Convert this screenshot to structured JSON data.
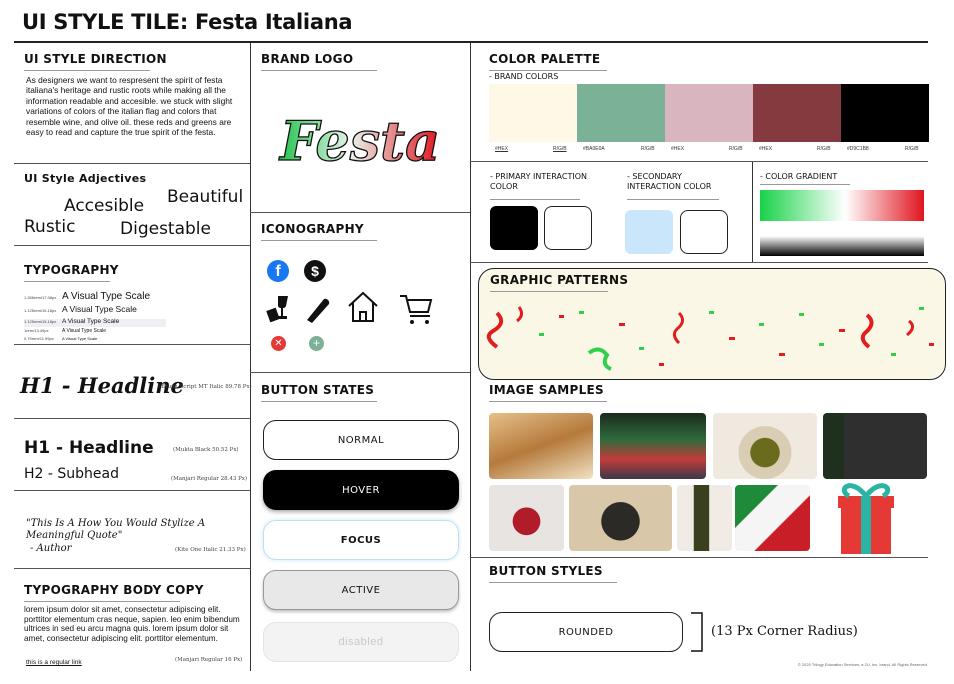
{
  "title": "UI STYLE TILE: Festa Italiana",
  "direction": {
    "heading": "UI STYLE DIRECTION",
    "text": "As designers we want to respresent the spirit of festa italiana's heritage and rustic roots while making all the information readable and accesible. we stuck with slight variations of colors of the italian flag and colors that resemble wine, and olive oil. these reds and greens are easy to read and capture the true spirit of the festa."
  },
  "adjectives": {
    "heading": "UI Style Adjectives",
    "words": [
      "Beautiful",
      "Accesible",
      "Rustic",
      "Digestable"
    ]
  },
  "typography": {
    "heading": "TYPOGRAPHY",
    "scale": [
      {
        "label": "1.266rem/17.08px",
        "text": "A Visual Type Scale"
      },
      {
        "label": "1.125rem/15.18px",
        "text": "A Visual Type Scale"
      },
      {
        "label": "1.125rem/15.18px",
        "text": "A Visual Type Scale"
      },
      {
        "label": "1rem/13.49px",
        "text": "A Visual Type Scale"
      },
      {
        "label": "0.79rem/11.99px",
        "text": "A Visual Type Scale"
      }
    ]
  },
  "h1script": {
    "text": "H1 - Headline",
    "note": "(Brush Script MT Italic 89.78 Px)"
  },
  "h1": {
    "text": "H1 - Headline",
    "note": "(Mukta Black 50.52 Px)"
  },
  "h2": {
    "text": "H2 - Subhead",
    "note": "(Manjari Regular 28.43 Px)"
  },
  "quote": {
    "text": "\"This Is A How You Would Stylize A Meaningful Quote\"",
    "author": "- Author",
    "note": "(Kite One Italic 21.33 Px)"
  },
  "body": {
    "heading": "TYPOGRAPHY BODY COPY",
    "text": "lorem ipsum dolor sit amet, consectetur adipiscing elit. porttitor elementum cras neque, sapien. leo enim bibendum ultrices in sed eu arcu magna quis. lorem ipsum dolor sit amet, consectetur adipiscing elit. porttitor elementum.",
    "link": "this is a regular link",
    "note": "(Manjari Regular 16 Px)"
  },
  "logo": {
    "heading": "BRAND LOGO",
    "text": "Festa"
  },
  "iconography": {
    "heading": "ICONOGRAPHY"
  },
  "buttons": {
    "heading": "BUTTON STATES",
    "normal": "NORMAL",
    "hover": "HOVER",
    "focus": "FOCUS",
    "active": "ACTIVE",
    "disabled": "disabled"
  },
  "palette": {
    "heading": "COLOR PALETTE",
    "sub": "- BRAND COLORS",
    "swatches": [
      {
        "color": "#FFF8E6",
        "hex": "#HEX",
        "rgb": "R/G/B"
      },
      {
        "color": "#7BB196",
        "hex": "#BA0E0A",
        "rgb": "R/G/B"
      },
      {
        "color": "#D9B5C0",
        "hex": "#HEX",
        "rgb": "R/G/B"
      },
      {
        "color": "#843A3E",
        "hex": "#HEX",
        "rgb": "R/G/B"
      },
      {
        "color": "#000000",
        "hex": "#D9C1B8",
        "rgb": "R/G/B"
      }
    ]
  },
  "interaction": {
    "primary": "- PRIMARY INTERACTION COLOR",
    "secondary": "- SECONDARY INTERACTION COLOR",
    "primary_color": "#000000",
    "secondary_color": "#C9E6FB"
  },
  "gradient": {
    "heading": "- COLOR GRADIENT"
  },
  "patterns": {
    "heading": "GRAPHIC PATTERNS"
  },
  "images": {
    "heading": "IMAGE SAMPLES"
  },
  "button_styles": {
    "heading": "BUTTON STYLES",
    "button": "ROUNDED",
    "note": "(13 Px Corner Radius)"
  },
  "footer": "© 2020 Trilogy Education Services, a 2U, Inc. brand. All Rights Reserved."
}
